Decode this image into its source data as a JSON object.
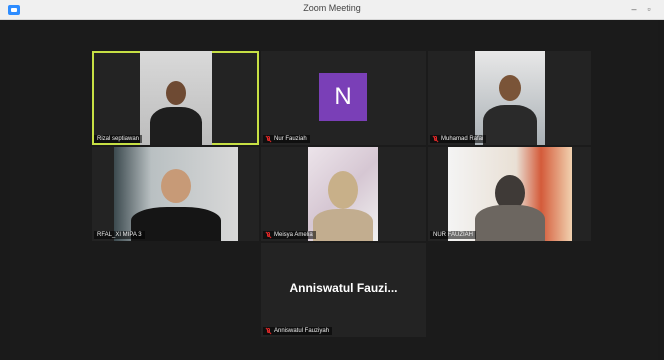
{
  "window": {
    "title": "Zoom Meeting",
    "minimize": "–",
    "maximize": "▫"
  },
  "participants": [
    {
      "name": "Rizal septiawan",
      "muted": false,
      "active": true
    },
    {
      "name": "Nur Fauziah",
      "muted": true,
      "avatar_letter": "N"
    },
    {
      "name": "Muhamad Rafai",
      "muted": true
    },
    {
      "name": "RFAL_XI MIPA 3",
      "muted": false
    },
    {
      "name": "Meisya Amelia",
      "muted": true
    },
    {
      "name": "NUR FAUZIAH",
      "muted": false
    },
    {
      "name": "Anniswatul Fauziyah",
      "muted": true,
      "display_name": "Anniswatul  Fauzi..."
    }
  ],
  "colors": {
    "active_border": "#c7e044",
    "avatar": "#7a3fb7",
    "mute": "#e02828"
  }
}
